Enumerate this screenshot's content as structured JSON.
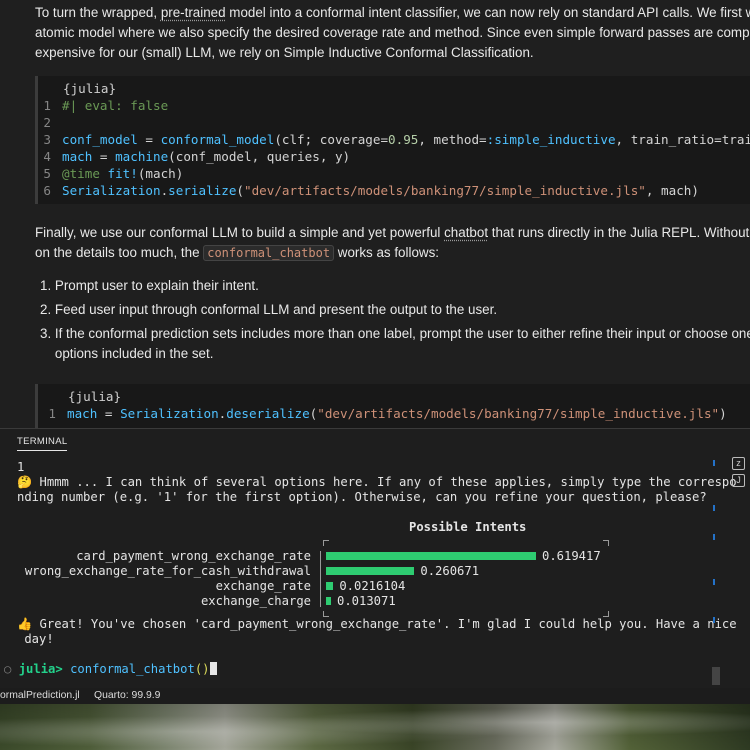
{
  "doc": {
    "para1": {
      "line1_a": "To turn the wrapped, ",
      "line1_u": "pre-trained",
      "line1_b": " model into a conformal intent classifier, we can now rely on standard API calls. We first wrap our",
      "line2": "atomic model where we also specify the desired coverage rate and method. Since even simple forward passes are computationally",
      "line3": "expensive for our (small) LLM, we rely on Simple Inductive Conformal Classification."
    },
    "code1": {
      "fence": "{julia}",
      "lines": [
        {
          "n": "1",
          "comment": "#| eval: false"
        },
        {
          "n": "2"
        },
        {
          "n": "3",
          "var": "conf_model",
          "eq": " = ",
          "fn": "conformal_model",
          "args_a": "(clf; coverage=",
          "num": "0.95",
          "args_b": ", method=",
          "sym": ":simple_inductive",
          "args_c": ", train_ratio=train_ratio)"
        },
        {
          "n": "4",
          "var": "mach",
          "eq": " = ",
          "fn": "machine",
          "args": "(conf_model, queries, y)"
        },
        {
          "n": "5",
          "macro": "@time",
          "fn": " fit!",
          "args": "(mach)"
        },
        {
          "n": "6",
          "mod": "Serialization",
          "dot": ".",
          "fn": "serialize",
          "str": "\"dev/artifacts/models/banking77/simple_inductive.jls\"",
          "args": ", mach)"
        }
      ]
    },
    "para2": {
      "line1_a": "Finally, we use our conformal LLM to build a simple and yet powerful ",
      "line1_u": "chatbot",
      "line1_b": " that runs directly in the Julia REPL. Without dwelling",
      "line2_a": "on the details too much, the ",
      "line2_code": "conformal_chatbot",
      "line2_b": " works as follows:"
    },
    "list": [
      "1. Prompt user to explain their intent.",
      "2. Feed user input through conformal LLM and present the output to the user.",
      "3. If the conformal prediction sets includes more than one label, prompt the user to either refine their input or choose one of the",
      "    options included in the set."
    ],
    "code2": {
      "fence": "{julia}",
      "n": "1",
      "var": "mach",
      "eq": " = ",
      "mod": "Serialization",
      "dot": ".",
      "fn": "deserialize",
      "str": "\"dev/artifacts/models/banking77/simple_inductive.jls\"",
      "close": ")"
    }
  },
  "terminal": {
    "tab": "TERMINAL",
    "line_1": "1",
    "msg1_emoji": "🤔",
    "msg1_a": " Hmmm ... I can think of several options here. If any of these applies, simply type the correspo",
    "msg1_b": "nding number (e.g. '1' for the first option). Otherwise, can you refine your question, please?",
    "chart_title": "Possible Intents",
    "msg2_emoji": "👍",
    "msg2_a": " Great! You've chosen 'card_payment_wrong_exchange_rate'. I'm glad I could help you. Have a nice",
    "msg2_b": " day!",
    "prompt": "julia>",
    "command": "conformal_chatbot",
    "parens": "()",
    "side_buttons": [
      "z",
      "J"
    ]
  },
  "chart_data": {
    "type": "bar",
    "orientation": "horizontal",
    "title": "Possible Intents",
    "categories": [
      "card_payment_wrong_exchange_rate",
      "wrong_exchange_rate_for_cash_withdrawal",
      "exchange_rate",
      "exchange_charge"
    ],
    "values": [
      0.619417,
      0.260671,
      0.0216104,
      0.013071
    ],
    "value_labels": [
      "0.619417",
      "0.260671",
      "0.0216104",
      "0.013071"
    ],
    "bar_color": "#2ecc71"
  },
  "status": {
    "item1": "ormalPrediction.jl",
    "item2": "Quarto: 99.9.9"
  }
}
